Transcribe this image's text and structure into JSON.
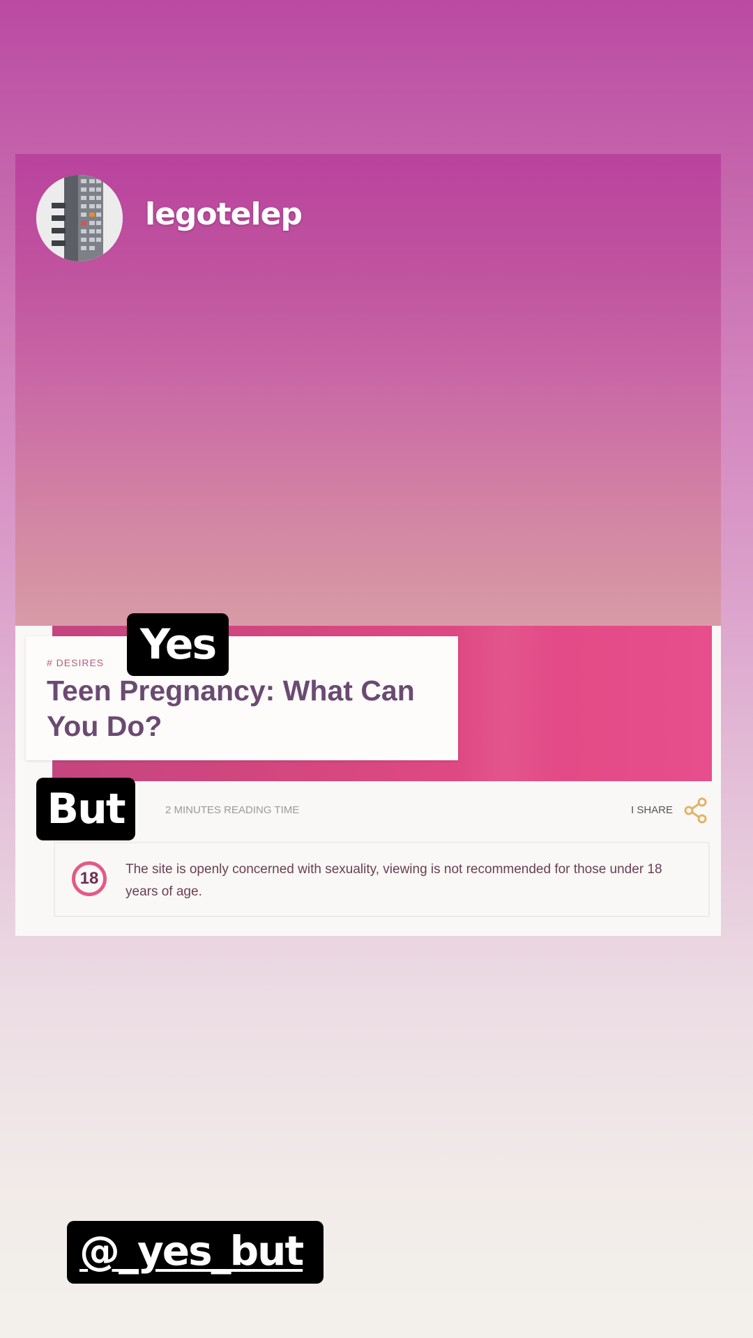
{
  "story": {
    "username": "legotelep",
    "avatar_icon": "building-photo-icon",
    "stickers": {
      "yes": "Yes",
      "but": "But",
      "handle": "@_yes_but"
    }
  },
  "article": {
    "category": "# DESIRES",
    "title": "Teen Pregnancy: What Can You Do?",
    "reading_time": "2 MINUTES READING TIME",
    "share_label": "I SHARE",
    "share_icon": "share-icon",
    "notice": {
      "badge": "18",
      "text": "The site is openly concerned with sexuality, viewing is not recommended for those under 18 years of age."
    }
  },
  "colors": {
    "top_pink": "#bb4aa2",
    "accent_pink": "#e35a86",
    "title_purple": "#6b4a72"
  }
}
